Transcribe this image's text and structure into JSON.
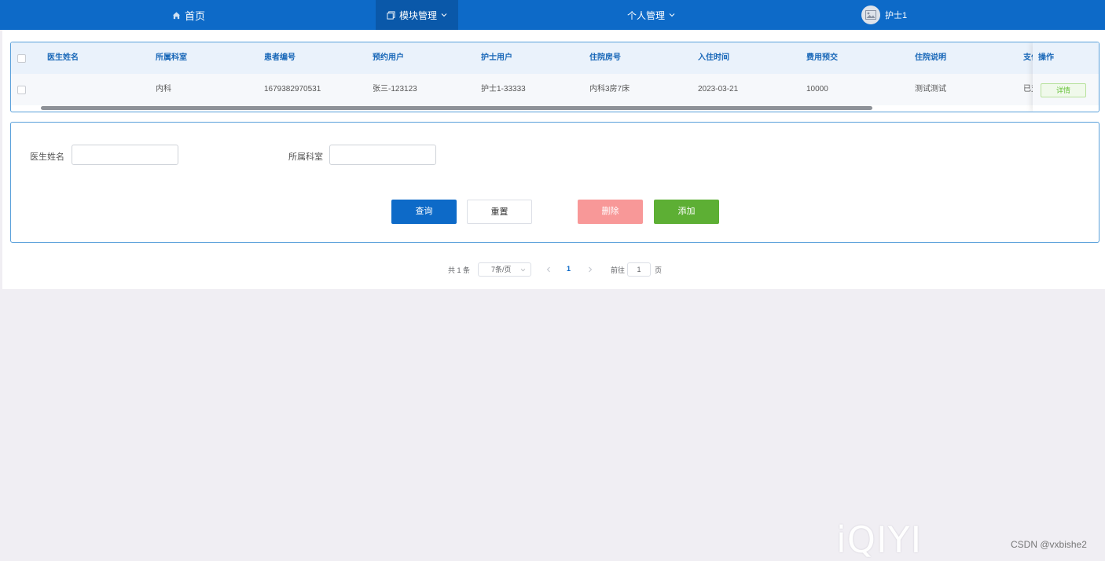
{
  "nav": {
    "home": "首页",
    "module_mgmt": "模块管理",
    "personal_mgmt": "个人管理",
    "user": "护士1"
  },
  "table": {
    "headers": [
      "医生姓名",
      "所属科室",
      "患者编号",
      "预约用户",
      "护士用户",
      "住院房号",
      "入住时间",
      "费用预交",
      "住院说明",
      "支付"
    ],
    "action_header": "操作",
    "rows": [
      {
        "cells": [
          "",
          "内科",
          "1679382970531",
          "张三-123123",
          "护士1-33333",
          "内科3房7床",
          "2023-03-21",
          "10000",
          "测试测试",
          "已支"
        ],
        "action": "详情"
      }
    ]
  },
  "search": {
    "doctor_label": "医生姓名",
    "dept_label": "所属科室",
    "doctor_value": "",
    "dept_value": "",
    "query": "查询",
    "reset": "重置",
    "delete": "删除",
    "add": "添加"
  },
  "pagination": {
    "total": "共 1 条",
    "page_size": "7条/页",
    "current": "1",
    "goto_label": "前往",
    "goto_value": "1",
    "page_suffix": "页"
  },
  "watermarks": {
    "iqiyi": "iQIYI",
    "csdn": "CSDN @vxbishe2"
  },
  "colors": {
    "nav_bg": "#0d6ac8",
    "primary": "#0d6ac8",
    "danger_light": "#f89898",
    "success": "#5daf34"
  }
}
